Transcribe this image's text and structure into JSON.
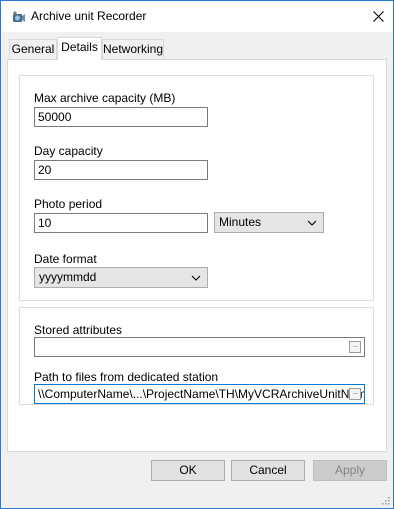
{
  "window": {
    "title": "Archive unit Recorder",
    "icon": "recorder-app-icon",
    "close_icon": "close-icon"
  },
  "tabs": [
    {
      "label": "General",
      "active": false
    },
    {
      "label": "Details",
      "active": true
    },
    {
      "label": "Networking",
      "active": false
    }
  ],
  "details": {
    "max_capacity": {
      "label": "Max archive capacity (MB)",
      "value": "50000"
    },
    "day_capacity": {
      "label": "Day capacity",
      "value": "20"
    },
    "photo_period": {
      "label": "Photo period",
      "value": "10",
      "unit_selected": "Minutes"
    },
    "date_format": {
      "label": "Date format",
      "selected": "yyyymmdd"
    }
  },
  "attributes": {
    "stored_attributes": {
      "label": "Stored attributes",
      "value": ""
    },
    "path": {
      "label": "Path to files from dedicated station",
      "value": "\\\\ComputerName\\...\\ProjectName\\TH\\MyVCRArchiveUnitName"
    }
  },
  "buttons": {
    "ok": "OK",
    "cancel": "Cancel",
    "apply": "Apply"
  },
  "colors": {
    "focus_border": "#0078d7",
    "window_border": "#2b79d6"
  }
}
